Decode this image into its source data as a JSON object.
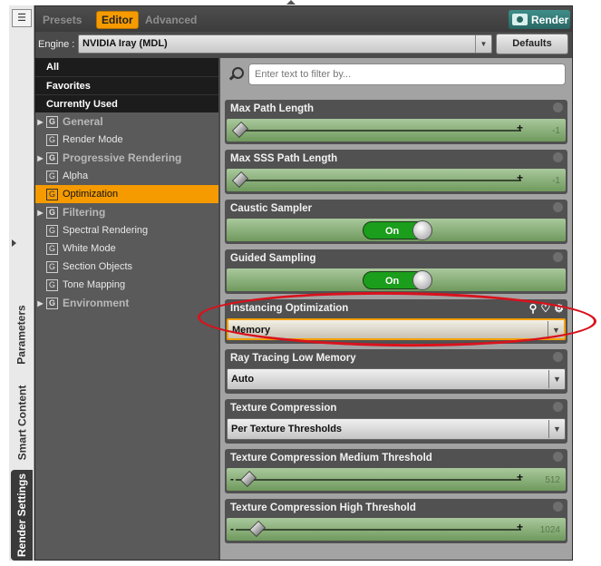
{
  "vertical_tabs": [
    "Parameters",
    "Smart Content",
    "Render Settings"
  ],
  "top_tabs": {
    "presets": "Presets",
    "editor": "Editor",
    "advanced": "Advanced"
  },
  "render_button": "Render",
  "engine": {
    "label": "Engine :",
    "value": "NVIDIA Iray (MDL)",
    "defaults": "Defaults"
  },
  "tree": {
    "filters": [
      "All",
      "Favorites",
      "Currently Used"
    ],
    "items": [
      {
        "label": "General",
        "group": true,
        "expandable": true
      },
      {
        "label": "Render Mode",
        "group": false
      },
      {
        "label": "Progressive Rendering",
        "group": true,
        "expandable": true
      },
      {
        "label": "Alpha",
        "group": false
      },
      {
        "label": "Optimization",
        "group": false,
        "selected": true
      },
      {
        "label": "Filtering",
        "group": true,
        "expandable": true
      },
      {
        "label": "Spectral Rendering",
        "group": false
      },
      {
        "label": "White Mode",
        "group": false
      },
      {
        "label": "Section Objects",
        "group": false
      },
      {
        "label": "Tone Mapping",
        "group": false
      },
      {
        "label": "Environment",
        "group": true,
        "expandable": true
      }
    ],
    "group_icon": "G"
  },
  "filter": {
    "placeholder": "Enter text to filter by..."
  },
  "properties": [
    {
      "title": "Max Path Length",
      "type": "slider",
      "value": "-1",
      "plus": "+",
      "minus": "",
      "handle_fraction": 0
    },
    {
      "title": "Max SSS Path Length",
      "type": "slider",
      "value": "-1",
      "plus": "+",
      "minus": "",
      "handle_fraction": 0
    },
    {
      "title": "Caustic Sampler",
      "type": "toggle",
      "value": "On"
    },
    {
      "title": "Guided Sampling",
      "type": "toggle",
      "value": "On"
    },
    {
      "title": "Instancing Optimization",
      "type": "dropdown",
      "value": "Memory",
      "highlighted": true
    },
    {
      "title": "Ray Tracing Low Memory",
      "type": "dropdown",
      "value": "Auto"
    },
    {
      "title": "Texture Compression",
      "type": "dropdown",
      "value": "Per Texture Thresholds"
    },
    {
      "title": "Texture Compression Medium Threshold",
      "type": "slider",
      "value": "512",
      "plus": "+",
      "minus": "-",
      "handle_fraction": 0.03
    },
    {
      "title": "Texture Compression High Threshold",
      "type": "slider",
      "value": "1024",
      "plus": "+",
      "minus": "-",
      "handle_fraction": 0.06
    }
  ],
  "colors": {
    "accent": "#f59b00",
    "toggle_on": "#1b9e1b",
    "annotation": "#d8121c",
    "render": "#2a6663"
  }
}
